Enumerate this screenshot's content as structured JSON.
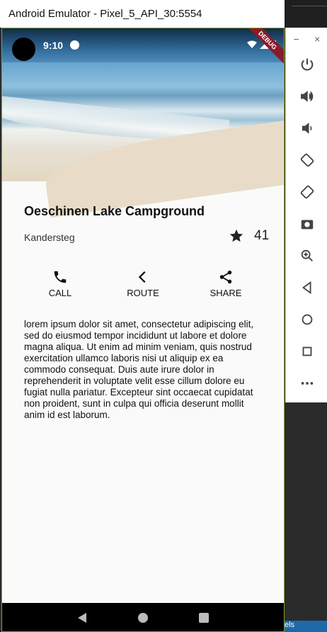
{
  "window": {
    "title": "Android Emulator - Pixel_5_API_30:5554"
  },
  "status_bar": {
    "time": "9:10",
    "debug_label": "DEBUG"
  },
  "content": {
    "title": "Oeschinen Lake Campground",
    "subtitle": "Kandersteg",
    "rating_count": "41",
    "actions": [
      {
        "label": "CALL",
        "icon": "phone-icon"
      },
      {
        "label": "ROUTE",
        "icon": "chevron-left-icon"
      },
      {
        "label": "SHARE",
        "icon": "share-icon"
      }
    ],
    "description": "lorem ipsum dolor sit amet, consectetur adipiscing elit, sed do eiusmod tempor incididunt ut labore et dolore magna aliqua. Ut enim ad minim veniam, quis nostrud exercitation ullamco laboris nisi ut aliquip ex ea commodo consequat. Duis aute irure dolor in reprehenderit in voluptate velit esse cillum dolore eu fugiat nulla pariatur. Excepteur sint occaecat cupidatat non proident, sunt in culpa qui officia deserunt mollit anim id est laborum."
  },
  "side_toolbar": {
    "window_controls": [
      "−",
      "×"
    ],
    "buttons": [
      "power-icon",
      "volume-up-icon",
      "volume-down-icon",
      "rotate-left-icon",
      "rotate-right-icon",
      "camera-icon",
      "zoom-icon",
      "back-icon",
      "home-icon",
      "overview-icon",
      "more-icon"
    ]
  },
  "taskbar": {
    "text": "els"
  },
  "colors": {
    "accent": "#8aa224",
    "debug": "#8b1a2b",
    "text": "#111111",
    "background": "#fafafa"
  }
}
